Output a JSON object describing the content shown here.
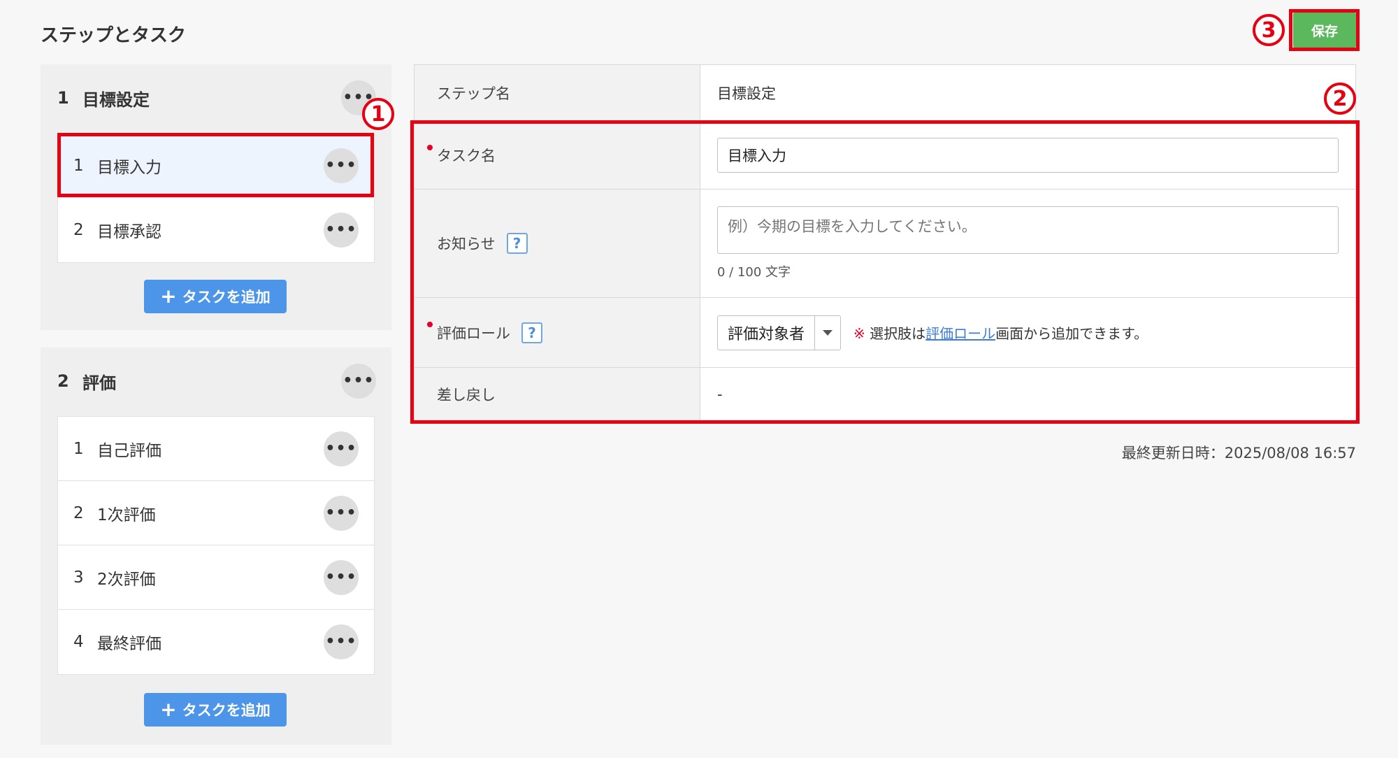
{
  "page_title": "ステップとタスク",
  "save_label": "保存",
  "steps": [
    {
      "num": "1",
      "name": "目標設定",
      "more": "•••",
      "tasks": [
        {
          "num": "1",
          "name": "目標入力",
          "more": "•••"
        },
        {
          "num": "2",
          "name": "目標承認",
          "more": "•••"
        }
      ],
      "add_task_label": "タスクを追加"
    },
    {
      "num": "2",
      "name": "評価",
      "more": "•••",
      "tasks": [
        {
          "num": "1",
          "name": "自己評価",
          "more": "•••"
        },
        {
          "num": "2",
          "name": "1次評価",
          "more": "•••"
        },
        {
          "num": "3",
          "name": "2次評価",
          "more": "•••"
        },
        {
          "num": "4",
          "name": "最終評価",
          "more": "•••"
        }
      ],
      "add_task_label": "タスクを追加"
    }
  ],
  "form": {
    "step_name_label": "ステップ名",
    "step_name_value": "目標設定",
    "task_name_label": "タスク名",
    "task_name_value": "目標入力",
    "notice_label": "お知らせ",
    "notice_placeholder": "例）今期の目標を入力してください。",
    "notice_counter": "0 / 100 文字",
    "role_label": "評価ロール",
    "role_value": "評価対象者",
    "role_note_mark": "※",
    "role_note_prefix": "選択肢は",
    "role_note_link": "評価ロール",
    "role_note_suffix": "画面から追加できます。",
    "sendback_label": "差し戻し",
    "sendback_value": "-",
    "help": "?"
  },
  "last_updated": "最終更新日時：2025/08/08 16:57",
  "annotations": {
    "one": "1",
    "two": "2",
    "three": "3"
  },
  "colors": {
    "accent": "#4c95e8",
    "save": "#5cb85c",
    "annotation": "#e60012",
    "required": "#e4002b"
  }
}
